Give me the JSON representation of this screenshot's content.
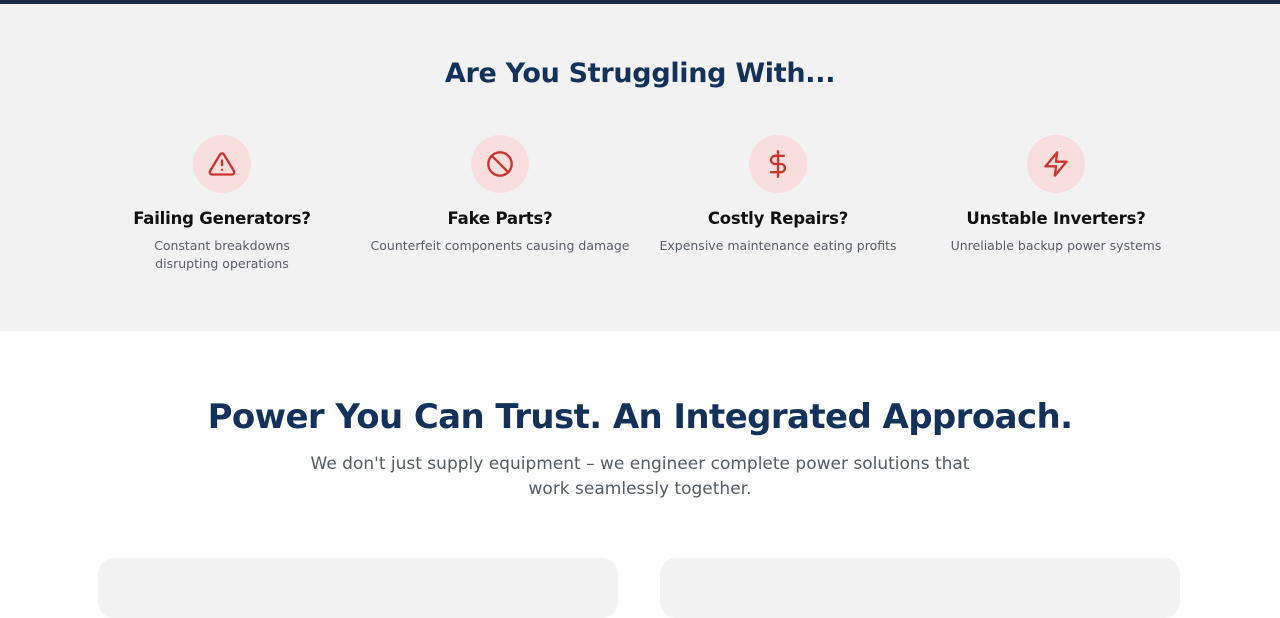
{
  "colors": {
    "navy": "#14315a",
    "icon_red": "#c7372f",
    "icon_bg": "#f9dede",
    "section_bg": "#f2f2f2"
  },
  "struggle": {
    "title": "Are You Struggling With...",
    "items": [
      {
        "icon": "alert-triangle-icon",
        "title": "Failing Generators?",
        "description": "Constant breakdowns disrupting operations"
      },
      {
        "icon": "ban-icon",
        "title": "Fake Parts?",
        "description": "Counterfeit components causing damage"
      },
      {
        "icon": "dollar-icon",
        "title": "Costly Repairs?",
        "description": "Expensive maintenance eating profits"
      },
      {
        "icon": "lightning-icon",
        "title": "Unstable Inverters?",
        "description": "Unreliable backup power systems"
      }
    ]
  },
  "approach": {
    "title": "Power You Can Trust. An Integrated Approach.",
    "subtitle": "We don't just supply equipment – we engineer complete power solutions that work seamlessly together."
  }
}
